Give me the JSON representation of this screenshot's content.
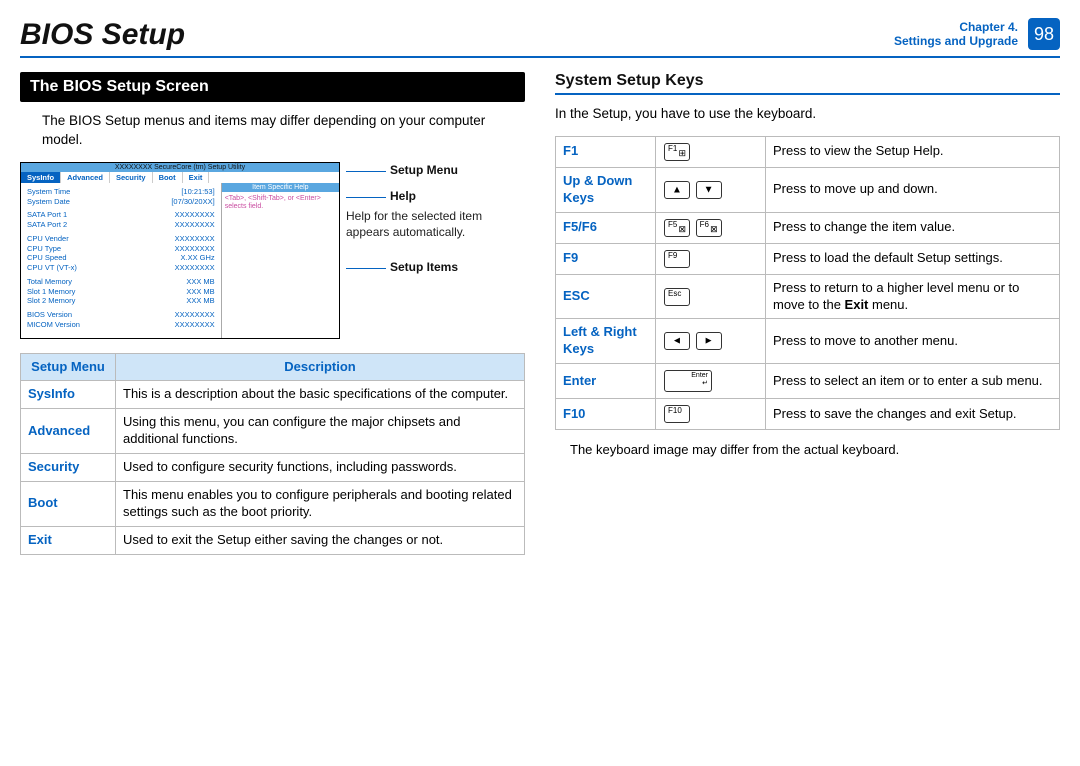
{
  "header": {
    "title": "BIOS Setup",
    "chapter_line1": "Chapter 4.",
    "chapter_line2": "Settings and Upgrade",
    "page_num": "98"
  },
  "section1": {
    "bar": "The BIOS Setup Screen",
    "intro": "The BIOS Setup menus and items may differ depending on your computer model.",
    "bios": {
      "top": "XXXXXXXX SecureCore (tm) Setup Utility",
      "tabs": [
        "SysInfo",
        "Advanced",
        "Security",
        "Boot",
        "Exit"
      ],
      "help_title": "Item Specific Help",
      "help_body": "<Tab>, <Shift-Tab>, or <Enter> selects field.",
      "rows": [
        {
          "k": "System Time",
          "v": "[10:21:53]"
        },
        {
          "k": "System Date",
          "v": "[07/30/20XX]"
        },
        {
          "k": "SATA Port 1",
          "v": "XXXXXXXX"
        },
        {
          "k": "SATA Port 2",
          "v": "XXXXXXXX"
        },
        {
          "k": "CPU Vender",
          "v": "XXXXXXXX"
        },
        {
          "k": "CPU Type",
          "v": "XXXXXXXX"
        },
        {
          "k": "CPU Speed",
          "v": "X.XX GHz"
        },
        {
          "k": "CPU VT (VT-x)",
          "v": "XXXXXXXX"
        },
        {
          "k": "Total Memory",
          "v": "XXX MB"
        },
        {
          "k": "Slot 1 Memory",
          "v": "XXX MB"
        },
        {
          "k": "Slot 2 Memory",
          "v": "XXX MB"
        },
        {
          "k": "BIOS Version",
          "v": "XXXXXXXX"
        },
        {
          "k": "MICOM Version",
          "v": "XXXXXXXX"
        }
      ]
    },
    "callouts": {
      "menu": "Setup Menu",
      "help": "Help",
      "help_desc": "Help for the selected item appears automatically.",
      "items": "Setup Items"
    },
    "table": {
      "head_menu": "Setup Menu",
      "head_desc": "Description",
      "rows": [
        {
          "menu": "SysInfo",
          "desc": "This is a description about the basic specifications of the computer."
        },
        {
          "menu": "Advanced",
          "desc": "Using this menu, you can configure the major chipsets and additional functions."
        },
        {
          "menu": "Security",
          "desc": "Used to configure security functions, including passwords."
        },
        {
          "menu": "Boot",
          "desc": "This menu enables you to configure peripherals and booting related settings such as the boot priority."
        },
        {
          "menu": "Exit",
          "desc": "Used to exit the Setup either saving the changes or not."
        }
      ]
    }
  },
  "section2": {
    "title": "System Setup Keys",
    "intro": "In the Setup, you have to use the keyboard.",
    "keys": [
      {
        "label": "F1",
        "cap": "F1",
        "desc": "Press to view the Setup Help."
      },
      {
        "label": "Up & Down Keys",
        "caps": [
          "▲",
          "▼"
        ],
        "desc": "Press to move up and down."
      },
      {
        "label": "F5/F6",
        "caps2": [
          "F5",
          "F6"
        ],
        "desc": "Press to change the item value."
      },
      {
        "label": "F9",
        "cap": "F9",
        "desc": "Press to load the default Setup settings."
      },
      {
        "label": "ESC",
        "cap": "Esc",
        "desc_html": "Press to return to a higher level menu or to move to the <b>Exit</b> menu."
      },
      {
        "label": "Left & Right Keys",
        "caps": [
          "◄",
          "►"
        ],
        "desc": "Press to move to another menu."
      },
      {
        "label": "Enter",
        "enter": true,
        "desc": "Press to select an item or to enter a sub menu."
      },
      {
        "label": "F10",
        "cap": "F10",
        "desc": "Press to save the changes and exit Setup."
      }
    ],
    "note": "The keyboard image may differ from the actual keyboard."
  }
}
